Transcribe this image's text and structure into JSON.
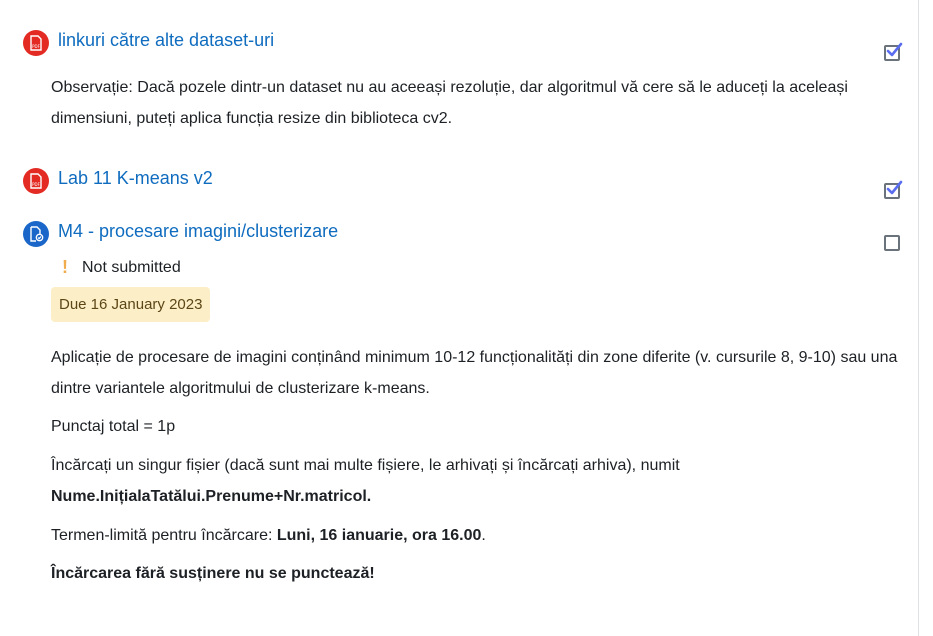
{
  "colors": {
    "link": "#0f6cbf",
    "pdf_icon": "#e32b24",
    "assign_icon": "#1a66c9",
    "check": "#5a6df0",
    "due_badge_bg": "#fcefc7",
    "warn": "#f0ad4e"
  },
  "activities": [
    {
      "icon": "file-pdf-icon",
      "title": "linkuri către alte dataset-uri",
      "completed": true,
      "description": "Observație: Dacă pozele dintr-un dataset nu au aceeași rezoluție, dar algoritmul vă cere să le aduceți la aceleași dimensiuni, puteți aplica funcția resize din biblioteca cv2."
    },
    {
      "icon": "file-pdf-icon",
      "title": "Lab 11 K-means v2",
      "completed": true
    },
    {
      "icon": "assignment-icon",
      "title": "M4 - procesare imagini/clusterizare",
      "completed": false,
      "status": "Not submitted",
      "due": "Due 16 January 2023",
      "description": {
        "p1": "Aplicație de procesare de imagini conținând minimum 10-12 funcționalități din zone diferite (v. cursurile 8, 9-10) sau una dintre variantele algoritmului de clusterizare k-means.",
        "p2": "Punctaj total = 1p",
        "p3_text": "Încărcați un singur fișier (dacă sunt mai multe fișiere, le arhivați și încărcați arhiva), numit",
        "p3_bold": "Nume.InițialaTatălui.Prenume+Nr.matricol.",
        "p4_text": "Termen-limită pentru încărcare: ",
        "p4_bold": "Luni, 16 ianuarie, ora 16.00",
        "p4_end": ".",
        "p5_bold": "Încărcarea fără susținere nu se punctează!"
      }
    }
  ]
}
